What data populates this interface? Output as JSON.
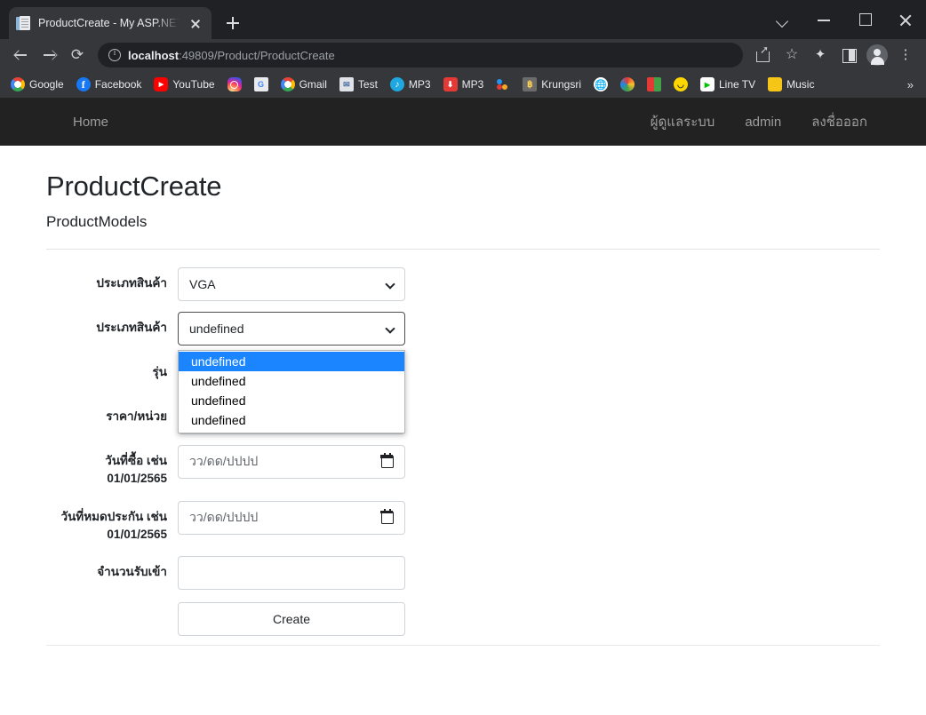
{
  "browser": {
    "tab": {
      "title": "ProductCreate - My ASP.NET App",
      "favicon": "document-icon",
      "close": "×"
    },
    "new_tab": "+",
    "window_controls": {
      "tab_search": "tab-search-icon",
      "minimize": "minimize-icon",
      "maximize": "maximize-icon",
      "close": "close-icon"
    },
    "toolbar": {
      "back": "back-icon",
      "forward": "forward-icon",
      "reload": "⟳",
      "site_info": "info-icon",
      "url_host": "localhost",
      "url_rest": ":49809/Product/ProductCreate",
      "share": "share-icon",
      "bookmark_star": "☆",
      "extensions": "✦",
      "side_panel": "side-panel-icon",
      "profile": "avatar-icon",
      "menu": "⋮"
    },
    "bookmarks": [
      {
        "label": "Google",
        "icon": "google-icon"
      },
      {
        "label": "Facebook",
        "icon": "facebook-icon"
      },
      {
        "label": "YouTube",
        "icon": "youtube-icon"
      },
      {
        "label": "",
        "icon": "instagram-icon"
      },
      {
        "label": "",
        "icon": "google-translate-icon"
      },
      {
        "label": "Gmail",
        "icon": "gmail-icon"
      },
      {
        "label": "Test",
        "icon": "mail-test-icon"
      },
      {
        "label": "MP3",
        "icon": "mp3-blue-icon"
      },
      {
        "label": "MP3",
        "icon": "mp3-download-icon"
      },
      {
        "label": "",
        "icon": "dots-icon"
      },
      {
        "label": "Krungsri",
        "icon": "krungsri-icon"
      },
      {
        "label": "",
        "icon": "globe-icon"
      },
      {
        "label": "",
        "icon": "paint-icon"
      },
      {
        "label": "",
        "icon": "book-icon"
      },
      {
        "label": "",
        "icon": "smiley-icon"
      },
      {
        "label": "Line TV",
        "icon": "linetv-icon"
      },
      {
        "label": "Music",
        "icon": "music-folder-icon"
      }
    ],
    "bookmarks_overflow": "»"
  },
  "site": {
    "nav": {
      "brand": "Home",
      "links": [
        "ผู้ดูแลระบบ",
        "admin",
        "ลงชื่อออก"
      ]
    },
    "heading": "ProductCreate",
    "subheading": "ProductModels",
    "form": {
      "fields": [
        {
          "label": "ประเภทสินค้า",
          "type": "select",
          "value": "VGA"
        },
        {
          "label": "ประเภทสินค้า",
          "type": "select",
          "value": "undefined",
          "open": true
        },
        {
          "label": "รุ่น",
          "type": "text",
          "value": ""
        },
        {
          "label": "ราคา/หน่วย",
          "type": "text",
          "value": ""
        },
        {
          "label": "วันที่ซื้อ เช่น 01/01/2565",
          "type": "date",
          "placeholder": "วว/ดด/ปปปป"
        },
        {
          "label": "วันที่หมดประกัน เช่น 01/01/2565",
          "type": "date",
          "placeholder": "วว/ดด/ปปปป"
        },
        {
          "label": "จำนวนรับเข้า",
          "type": "text",
          "value": ""
        }
      ],
      "submit_label": "Create",
      "dropdown_options": [
        "undefined",
        "undefined",
        "undefined",
        "undefined"
      ],
      "dropdown_selected_index": 0
    }
  },
  "colors": {
    "chrome_dark": "#202124",
    "chrome_toolbar": "#35373a",
    "navbar": "#222222",
    "nav_link": "#9d9d9d",
    "option_highlight": "#1a85ff",
    "input_border": "#ced4da"
  }
}
